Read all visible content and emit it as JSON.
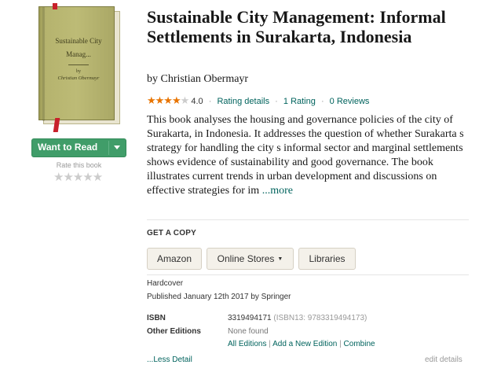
{
  "cover": {
    "title": "Sustainable City Manag...",
    "by": "by",
    "author": "Christian Obermayr"
  },
  "shelf": {
    "want_to_read": "Want to Read",
    "rate_label": "Rate this book",
    "rate_stars": "★★★★★"
  },
  "book": {
    "title": "Sustainable City Management: Informal Settlements in Surakarta, Indonesia",
    "by_prefix": "by",
    "author": "Christian Obermayr",
    "rating_stars_on": "★★★★",
    "rating_stars_off": "★",
    "average_rating": "4.0",
    "rating_details": "Rating details",
    "ratings_count": "1 Rating",
    "reviews_count": "0 Reviews",
    "description": "This book analyses the housing and governance policies of the city of Surakarta, in Indonesia. It addresses the question of whether Surakarta s strategy for handling the city s informal sector and marginal settlements shows evidence of sustainability and good governance. The book illustrates current trends in urban development and discussions on effective strategies for im",
    "more_link": "...more"
  },
  "get_a_copy": {
    "header": "GET A COPY",
    "amazon": "Amazon",
    "online_stores": "Online Stores",
    "online_stores_caret": "▼",
    "libraries": "Libraries"
  },
  "details": {
    "format": "Hardcover",
    "published": "Published January 12th 2017 by Springer",
    "isbn_label": "ISBN",
    "isbn": "3319494171",
    "isbn13": "(ISBN13: 9783319494173)",
    "other_editions_label": "Other Editions",
    "other_editions_value": "None found",
    "all_editions": "All Editions",
    "add_edition": "Add a New Edition",
    "combine": "Combine",
    "separator": "|",
    "less_detail": "...Less Detail",
    "edit_details": "edit details"
  },
  "colors": {
    "accent_green": "#409d69",
    "link": "#00635d",
    "star": "#e87400"
  }
}
